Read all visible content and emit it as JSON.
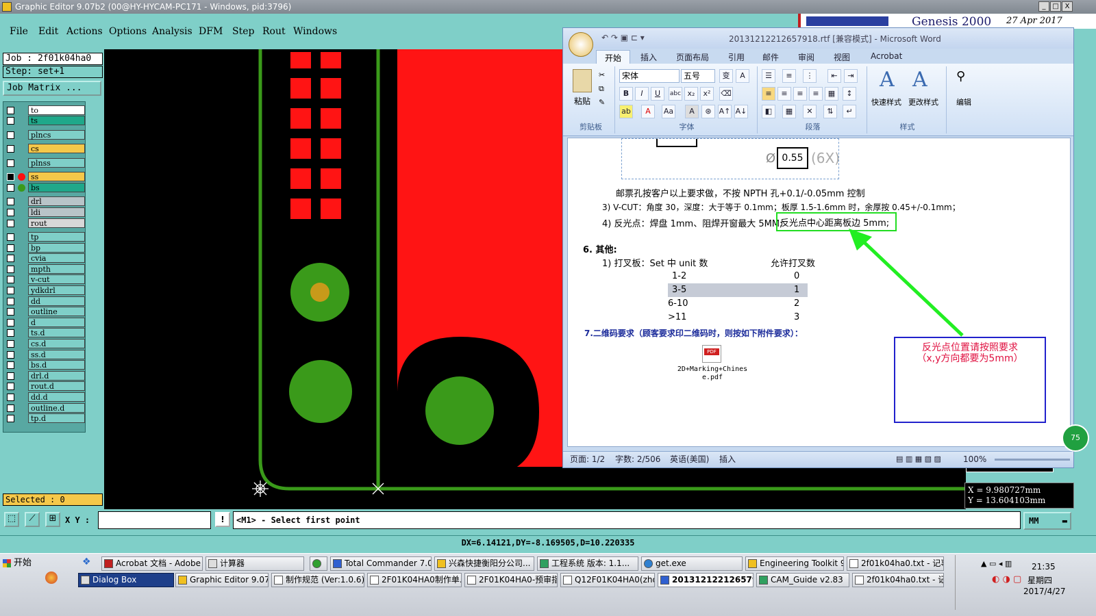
{
  "titlebar": {
    "title": "Graphic Editor 9.07b2 (00@HY-HYCAM-PC171 - Windows, pid:3796)",
    "min": "_",
    "max": "□",
    "close": "X"
  },
  "menu": [
    "File",
    "Edit",
    "Actions",
    "Options",
    "Analysis",
    "DFM",
    "Step",
    "Rout",
    "Windows"
  ],
  "job": {
    "job_line": "Job : 2f01k04ha0",
    "step_line": "Step: set+1",
    "matrix_button": "Job Matrix ..."
  },
  "layers": [
    {
      "name": "to",
      "color": "#ffffff",
      "checked": false
    },
    {
      "name": "ts",
      "color": "#1fa88a",
      "checked": false
    },
    {
      "name": "plncs",
      "color": "#7fcfc8",
      "checked": false
    },
    {
      "name": "cs",
      "color": "#f5c84a",
      "checked": false
    },
    {
      "name": "plnss",
      "color": "#7fcfc8",
      "checked": false
    },
    {
      "name": "ss",
      "color": "#f5c84a",
      "checked": true,
      "dot": "#ff1010"
    },
    {
      "name": "bs",
      "color": "#1fa88a",
      "checked": false,
      "dot": "#3a9a1a"
    },
    {
      "name": "drl",
      "color": "#b8c4c8",
      "checked": false
    },
    {
      "name": "ldi",
      "color": "#b8c4c8",
      "checked": false
    },
    {
      "name": "rout",
      "color": "#d8d8d8",
      "checked": false
    },
    {
      "name": "tp",
      "color": "#7fcfc8",
      "checked": false
    },
    {
      "name": "bp",
      "color": "#7fcfc8",
      "checked": false
    },
    {
      "name": "cvia",
      "color": "#7fcfc8",
      "checked": false
    },
    {
      "name": "mpth",
      "color": "#7fcfc8",
      "checked": false
    },
    {
      "name": "v-cut",
      "color": "#7fcfc8",
      "checked": false
    },
    {
      "name": "ydkdrl",
      "color": "#7fcfc8",
      "checked": false
    },
    {
      "name": "dd",
      "color": "#7fcfc8",
      "checked": false
    },
    {
      "name": "outline",
      "color": "#7fcfc8",
      "checked": false
    },
    {
      "name": "d",
      "color": "#7fcfc8",
      "checked": false
    },
    {
      "name": "ts.d",
      "color": "#7fcfc8",
      "checked": false
    },
    {
      "name": "cs.d",
      "color": "#7fcfc8",
      "checked": false
    },
    {
      "name": "ss.d",
      "color": "#7fcfc8",
      "checked": false
    },
    {
      "name": "bs.d",
      "color": "#7fcfc8",
      "checked": false
    },
    {
      "name": "drl.d",
      "color": "#7fcfc8",
      "checked": false
    },
    {
      "name": "rout.d",
      "color": "#7fcfc8",
      "checked": false
    },
    {
      "name": "dd.d",
      "color": "#7fcfc8",
      "checked": false
    },
    {
      "name": "outline.d",
      "color": "#7fcfc8",
      "checked": false
    },
    {
      "name": "tp.d",
      "color": "#7fcfc8",
      "checked": false
    }
  ],
  "selected": "Selected : 0",
  "coords": {
    "x": "X = 9.980727mm",
    "y": "Y = 13.604103mm"
  },
  "cmd": {
    "xy_label": "X Y :",
    "xy_value": "",
    "prompt": "<M1> - Select first point",
    "units": "MM"
  },
  "dx_readout": "DX=6.14121,DY=-8.169505,D=10.220335",
  "genesis": {
    "title": "Genesis 2000",
    "date": "27 Apr 2017"
  },
  "word": {
    "title": "20131212212657918.rtf [兼容模式] - Microsoft Word",
    "tabs": [
      "开始",
      "插入",
      "页面布局",
      "引用",
      "邮件",
      "审阅",
      "视图",
      "Acrobat"
    ],
    "groups": [
      "剪贴板",
      "字体",
      "段落",
      "样式",
      "编辑"
    ],
    "paste": "粘贴",
    "font_name": "宋体",
    "font_size": "五号",
    "styles_quick": "快速样式",
    "styles_change": "更改样式",
    "edit": "编辑",
    "doc": {
      "fig_value": "0.55",
      "fig_suffix": "(6X)",
      "fig_phi": "Ø",
      "line1": "邮票孔按客户以上要求做，不按 NPTH 孔+0.1/-0.05mm 控制",
      "line2": "3)  V-CUT：角度 30，深度：大于等于 0.1mm；板厚 1.5-1.6mm 时，余厚按 0.45+/-0.1mm；",
      "line3a": "4)  反光点：焊盘 1mm、阻焊开窗最大 5MM;",
      "line3b": "反光点中心距离板边 5mm;",
      "sec6": "6.  其他:",
      "line6_1a": "1)  打叉板：Set 中 unit 数",
      "line6_1b": "允许打叉数",
      "table": [
        [
          "1-2",
          "0"
        ],
        [
          "3-5",
          "1"
        ],
        [
          "6-10",
          "2"
        ],
        [
          ">11",
          "3"
        ]
      ],
      "sec7": "7.二维码要求（顾客要求印二维码时，则按如下附件要求）：",
      "attachment": "2D+Marking+Chines e.pdf",
      "pdf_label": "PDF",
      "note_line1": "反光点位置请按照要求",
      "note_line2": "（x,y方向都要为5mm）"
    },
    "status": {
      "page": "页面: 1/2",
      "words": "字数: 2/506",
      "lang": "英语(美国)",
      "mode": "插入",
      "zoom": "100%"
    }
  },
  "taskbar": {
    "start": "开始",
    "row1": [
      "Acrobat 文档 - Adobe ...",
      "计算器",
      "",
      "Total Commander 7.0 p...",
      "兴森快捷衡阳分公司...",
      "工程系统  版本: 1.1...",
      "get.exe",
      "Engineering Toolkit 9.0...",
      "2f01k04ha0.txt - 记事本"
    ],
    "row2": [
      "Dialog Box",
      "Graphic Editor 9.07b...",
      "制作规范 (Ver:1.0.6)",
      "2F01K04HA0制作单....",
      "2F01K04HA0-预审指...",
      "Q12F01K04HA0(zhou...",
      "201312122126579...",
      "CAM_Guide v2.83",
      "2f01k04ha0.txt - 记..."
    ],
    "time": "21:35",
    "weekday": "星期四",
    "date": "2017/4/27",
    "badge": "75"
  }
}
